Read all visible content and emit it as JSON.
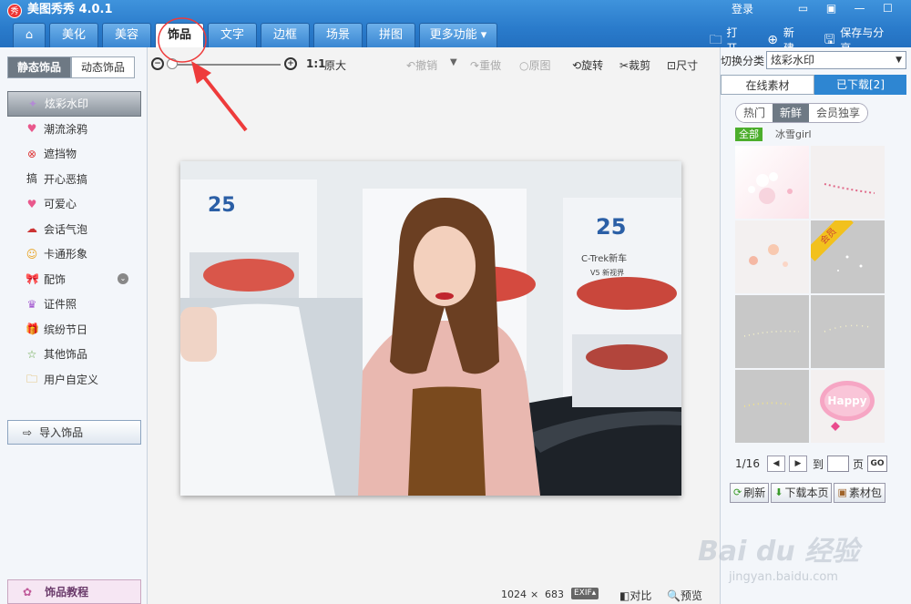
{
  "app": {
    "logo_text": "秀",
    "title": "美图秀秀 4.0.1",
    "login": "登录"
  },
  "tabs": [
    {
      "label": "⌂",
      "w": 36
    },
    {
      "label": "美化",
      "w": 54
    },
    {
      "label": "美容",
      "w": 54
    },
    {
      "label": "饰品",
      "w": 54,
      "active": true
    },
    {
      "label": "文字",
      "w": 54
    },
    {
      "label": "边框",
      "w": 54
    },
    {
      "label": "场景",
      "w": 54
    },
    {
      "label": "拼图",
      "w": 54
    },
    {
      "label": "更多功能 ▾",
      "w": 86
    }
  ],
  "actions": {
    "open": "打开",
    "new": "新建",
    "save": "保存与分享"
  },
  "left": {
    "subtabs": [
      "静态饰品",
      "动态饰品"
    ],
    "categories": [
      "炫彩水印",
      "潮流涂鸦",
      "遮挡物",
      "开心恶搞",
      "可爱心",
      "会话气泡",
      "卡通形象",
      "配饰",
      "证件照",
      "缤纷节日",
      "其他饰品",
      "用户自定义"
    ],
    "import": "导入饰品",
    "tutorial": "饰品教程"
  },
  "toolbar": {
    "ratio": "1:1",
    "original_size": "原大",
    "undo": "撤销",
    "redo": "重做",
    "original": "原图",
    "rotate": "旋转",
    "crop": "裁剪",
    "size": "尺寸"
  },
  "status": {
    "width": "1024",
    "times": "×",
    "height": "683",
    "exif": "EXIF▴",
    "compare": "对比",
    "preview": "预览"
  },
  "right": {
    "switch_label": "切换分类",
    "select_value": "炫彩水印",
    "tabs": [
      "在线素材",
      "已下载[2]"
    ],
    "pills": [
      "热门",
      "新鲜",
      "会员独享"
    ],
    "filter_all": "全部",
    "filter_user": "冰雪girl",
    "badge": "会员",
    "happy_text": "Happy",
    "page": "1/16",
    "goto": "到",
    "page_unit": "页",
    "go": "GO",
    "refresh": "刷新",
    "download": "下载本页",
    "package": "素材包"
  },
  "photo": {
    "banner_number": "25",
    "banner_text": "C-Trek新车",
    "banner_sub": "V5 新视界"
  },
  "watermark": {
    "text": "Bai du 经验",
    "url": "jingyan.baidu.com"
  }
}
